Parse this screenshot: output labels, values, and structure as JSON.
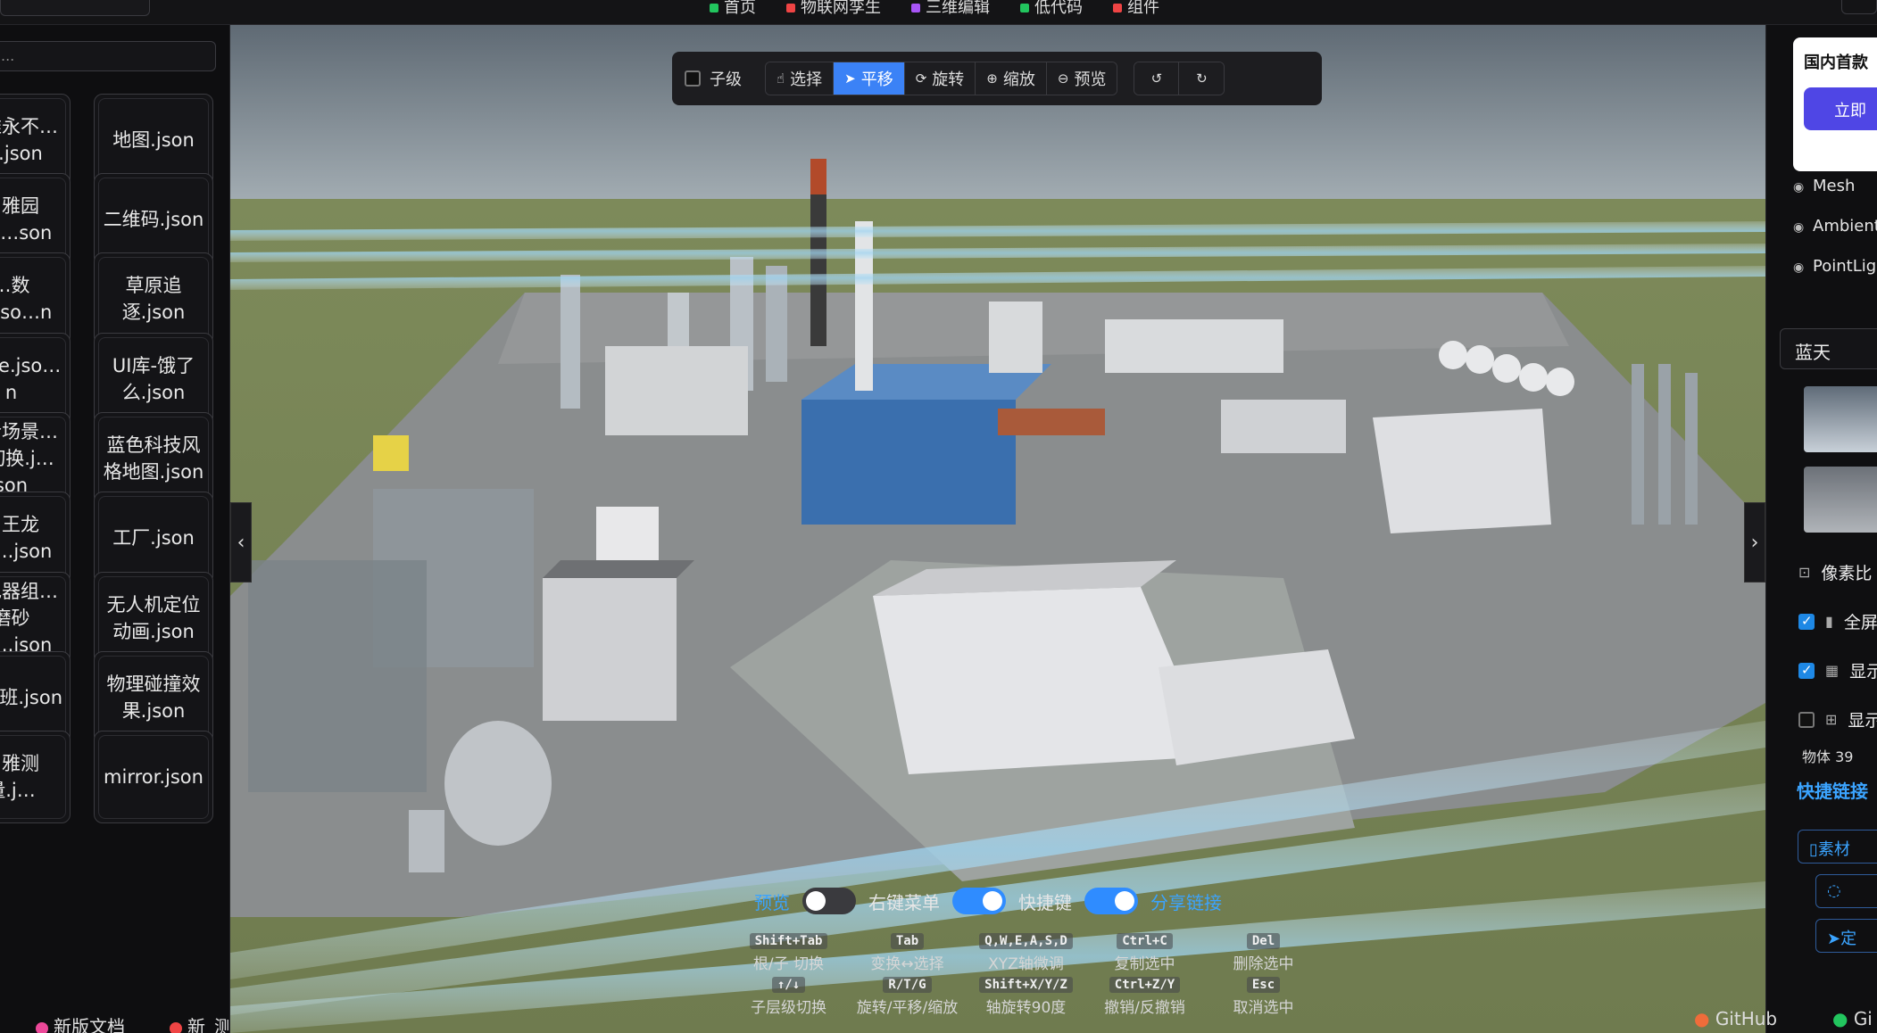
{
  "topnav": {
    "items": [
      {
        "label": "首页",
        "color": "#22c55e"
      },
      {
        "label": "物联网孪生",
        "color": "#ef4444"
      },
      {
        "label": "三维编辑",
        "color": "#a855f7"
      },
      {
        "label": "低代码",
        "color": "#22c55e"
      },
      {
        "label": "组件",
        "color": "#ef4444"
      }
    ]
  },
  "sidebar": {
    "filter_placeholder": "...",
    "cards_left": [
      "…雅永不…寸.json",
      "…雅园区.j…son",
      "…数区.jso…n",
      "…fee.jso…n",
      "…合场景…自切换.j…son",
      "…王龙百….json",
      "…色器组…磨砂反….json",
      "…班.json",
      "…雅测量.j…"
    ],
    "cards_right": [
      "地图.json",
      "二维码.json",
      "草原追逐.json",
      "UI库-饿了么.json",
      "蓝色科技风格地图.json",
      "工厂.json",
      "无人机定位动画.json",
      "物理碰撞效果.json",
      "mirror.json"
    ],
    "bottom_links": [
      {
        "label": "新版文档",
        "color": "#ec4899"
      },
      {
        "label": "新_测试版",
        "color": "#ef4444"
      }
    ]
  },
  "toolbar": {
    "child_level_label": "子级",
    "buttons": [
      {
        "label": "选择",
        "glyph": "☝"
      },
      {
        "label": "平移",
        "glyph": "➤"
      },
      {
        "label": "旋转",
        "glyph": "⟳"
      },
      {
        "label": "缩放",
        "glyph": "⊕"
      },
      {
        "label": "预览",
        "glyph": "⊖"
      }
    ],
    "undo_glyph": "↺",
    "redo_glyph": "↻",
    "active_mode": "平移"
  },
  "viewport": {
    "left_arrow": "‹",
    "right_arrow": "›",
    "toggles": {
      "preview_label": "预览",
      "preview_on": false,
      "context_menu_label": "右键菜单",
      "context_menu_on": true,
      "shortcuts_label": "快捷键",
      "shortcuts_on": true,
      "share_label": "分享链接"
    },
    "shortcuts": [
      {
        "key": "Shift+Tab",
        "desc": "根/子 切换"
      },
      {
        "key": "Tab",
        "desc": "变换↔选择"
      },
      {
        "key": "Q,W,E,A,S,D",
        "desc": "XYZ轴微调"
      },
      {
        "key": "Ctrl+C",
        "desc": "复制选中"
      },
      {
        "key": "Del",
        "desc": "删除选中"
      },
      {
        "key": "↑/↓",
        "desc": "子层级切换"
      },
      {
        "key": "R/T/G",
        "desc": "旋转/平移/缩放"
      },
      {
        "key": "Shift+X/Y/Z",
        "desc": "轴旋转90度"
      },
      {
        "key": "Ctrl+Z/Y",
        "desc": "撤销/反撤销"
      },
      {
        "key": "Esc",
        "desc": "取消选中"
      }
    ]
  },
  "rightpanel": {
    "promo_title": "国内首款",
    "promo_button": "立即",
    "tree": [
      "Mesh",
      "Ambient",
      "PointLig"
    ],
    "sky_select": "蓝天",
    "options": [
      {
        "label": "像素比",
        "checked": null,
        "glyph": "⊡"
      },
      {
        "label": "全屏",
        "checked": true,
        "glyph": "▮"
      },
      {
        "label": "显示",
        "checked": true,
        "glyph": "▦"
      },
      {
        "label": "显示",
        "checked": false,
        "glyph": "⊞"
      }
    ],
    "object_count": "物体 39",
    "quick_links_title": "快捷链接",
    "link_buttons": [
      {
        "label": "素材",
        "glyph": "▯"
      },
      {
        "label": "",
        "glyph": "◌"
      },
      {
        "label": "定",
        "glyph": "➤"
      }
    ],
    "github_label": "GitHub",
    "gitee_label": "Gi"
  }
}
